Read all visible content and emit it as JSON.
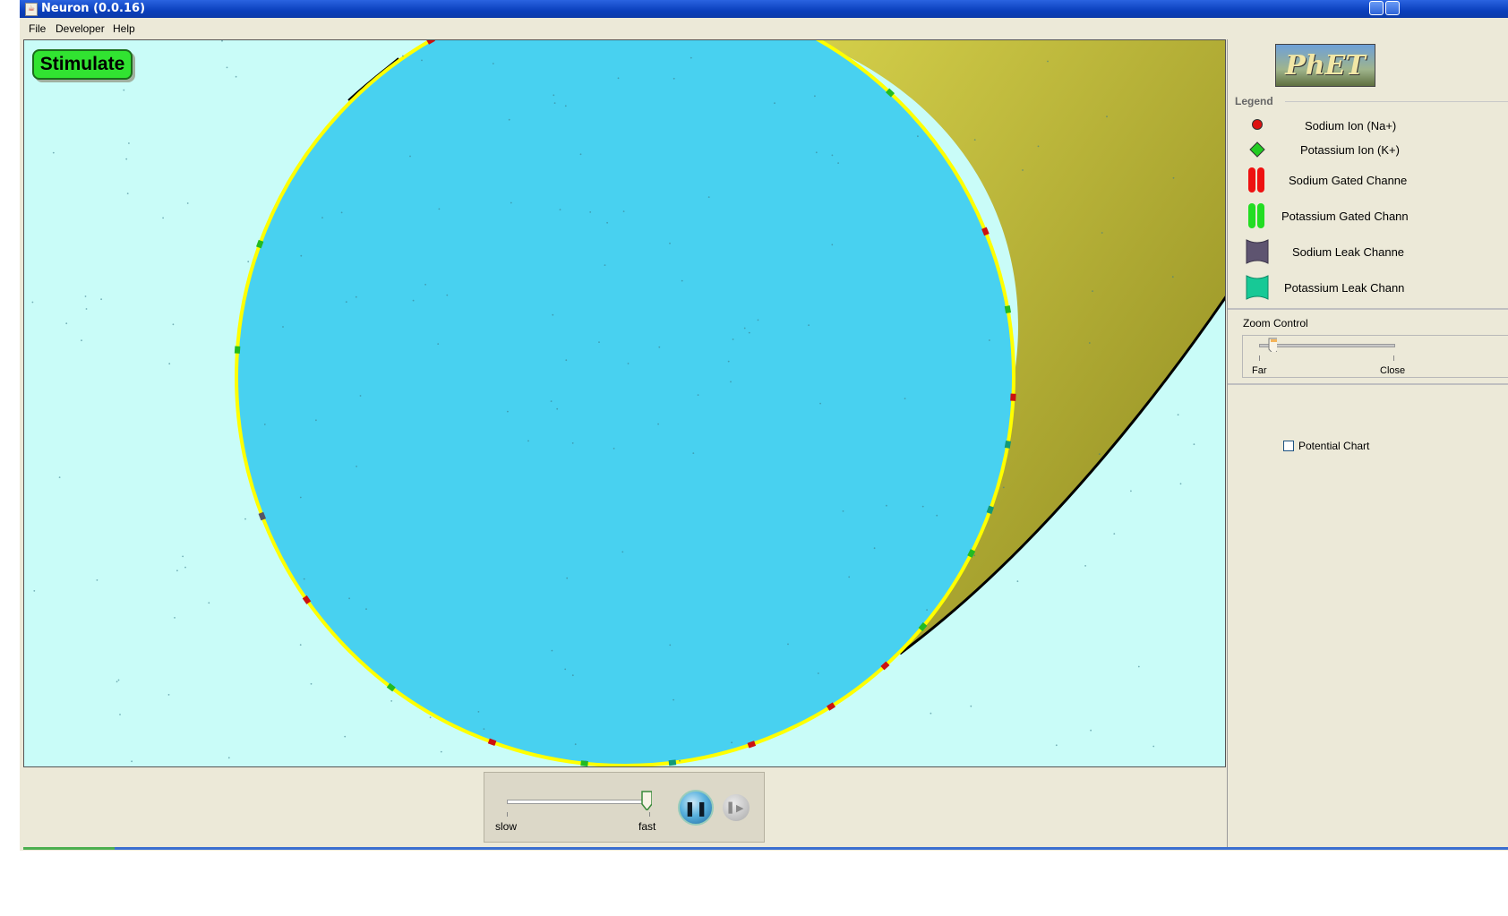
{
  "window": {
    "title": "Neuron (0.0.16)",
    "app_icon": "java-icon"
  },
  "menu": {
    "file": "File",
    "developer": "Developer",
    "help": "Help"
  },
  "sim": {
    "stimulate_label": "Stimulate",
    "colors": {
      "background": "#c9fcf8",
      "cell_body": "#48d1f0",
      "membrane": "#ffff00",
      "axon": "#a59a2a",
      "sodium_channel": "#cc1111",
      "potassium_channel": "#22bb22",
      "sodium_leak": "#555566",
      "potassium_leak": "#119977"
    }
  },
  "panel": {
    "logo_text": "PhET",
    "legend": {
      "title": "Legend",
      "items": [
        {
          "label": "Sodium Ion (Na+)",
          "icon": "sodium-ion-icon"
        },
        {
          "label": "Potassium Ion (K+)",
          "icon": "potassium-ion-icon"
        },
        {
          "label": "Sodium Gated Channe",
          "icon": "sodium-gated-channel-icon"
        },
        {
          "label": "Potassium Gated Chann",
          "icon": "potassium-gated-channel-icon"
        },
        {
          "label": "Sodium Leak Channe",
          "icon": "sodium-leak-channel-icon"
        },
        {
          "label": "Potassium Leak Chann",
          "icon": "potassium-leak-channel-icon"
        }
      ]
    },
    "zoom": {
      "label": "Zoom Control",
      "far": "Far",
      "close": "Close",
      "level": 0.1
    },
    "potential_chart_label": "Potential Chart",
    "potential_chart_checked": false
  },
  "clock": {
    "slow": "slow",
    "fast": "fast",
    "speed": 1.0,
    "pause_icon": "pause-icon",
    "step_icon": "step-icon"
  }
}
